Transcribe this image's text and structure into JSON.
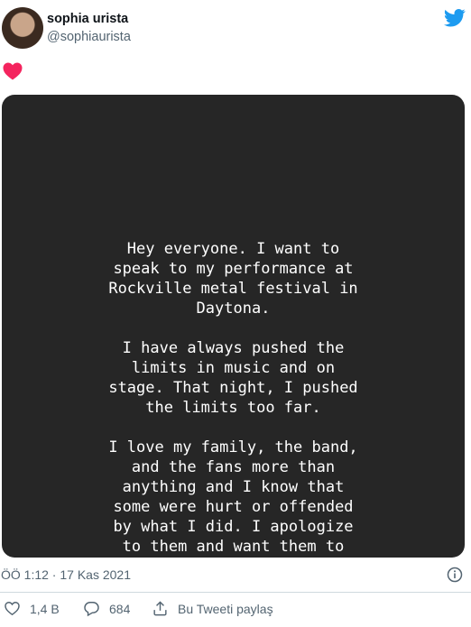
{
  "tweet": {
    "author": {
      "display_name": "sophia urista",
      "handle": "@sophiaurista",
      "avatar_icon": "avatar-photo"
    },
    "brand_icon": "twitter-bird-icon",
    "text_emoji": "heart-emoji",
    "story_image": {
      "background": "#262626",
      "text": "Hey everyone. I want to\nspeak to my performance at\nRockville metal festival in\nDaytona.\n\nI have always pushed the\nlimits in music and on\nstage. That night, I pushed\nthe limits too far.\n\nI love my family, the band,\nand the fans more than\nanything and I know that\nsome were hurt or offended\nby what I did. I apologize\nto them and want them to"
    },
    "timestamp": "ÖÖ 1:12 · 17 Kas 2021",
    "actions": {
      "like_count": "1,4 B",
      "reply_count": "684",
      "share_label": "Bu Tweeti paylaş"
    }
  },
  "colors": {
    "accent": "#1d9bf0",
    "heart": "#f4245e",
    "muted": "#536471"
  }
}
